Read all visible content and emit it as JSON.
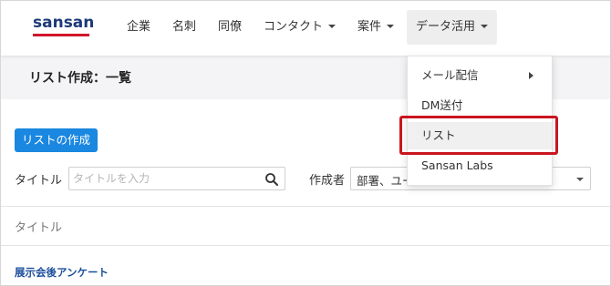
{
  "header": {
    "logo_text": "sansan",
    "nav": [
      {
        "label": "企業",
        "has_caret": false
      },
      {
        "label": "名刺",
        "has_caret": false
      },
      {
        "label": "同僚",
        "has_caret": false
      },
      {
        "label": "コンタクト",
        "has_caret": true
      },
      {
        "label": "案件",
        "has_caret": true
      },
      {
        "label": "データ活用",
        "has_caret": true,
        "active": true
      }
    ]
  },
  "page": {
    "title": "リスト作成：一覧",
    "create_button": "リストの作成"
  },
  "filters": {
    "title_label": "タイトル",
    "title_placeholder": "タイトルを入力",
    "author_label": "作成者",
    "author_value": "部署、ユー"
  },
  "table": {
    "column_header": "タイトル",
    "rows": [
      {
        "title": "展示会後アンケート"
      }
    ]
  },
  "dropdown": {
    "items": [
      {
        "label": "メール配信",
        "has_submenu": true
      },
      {
        "label": "DM送付",
        "has_submenu": false
      },
      {
        "label": "リスト",
        "has_submenu": false,
        "highlighted": true
      },
      {
        "label": "Sansan Labs",
        "has_submenu": false
      }
    ]
  },
  "colors": {
    "brand_navy": "#1c3a78",
    "brand_red": "#d1152a",
    "primary_button": "#1a87e0",
    "link": "#1b4f9c",
    "highlight_border": "#c9151e"
  }
}
